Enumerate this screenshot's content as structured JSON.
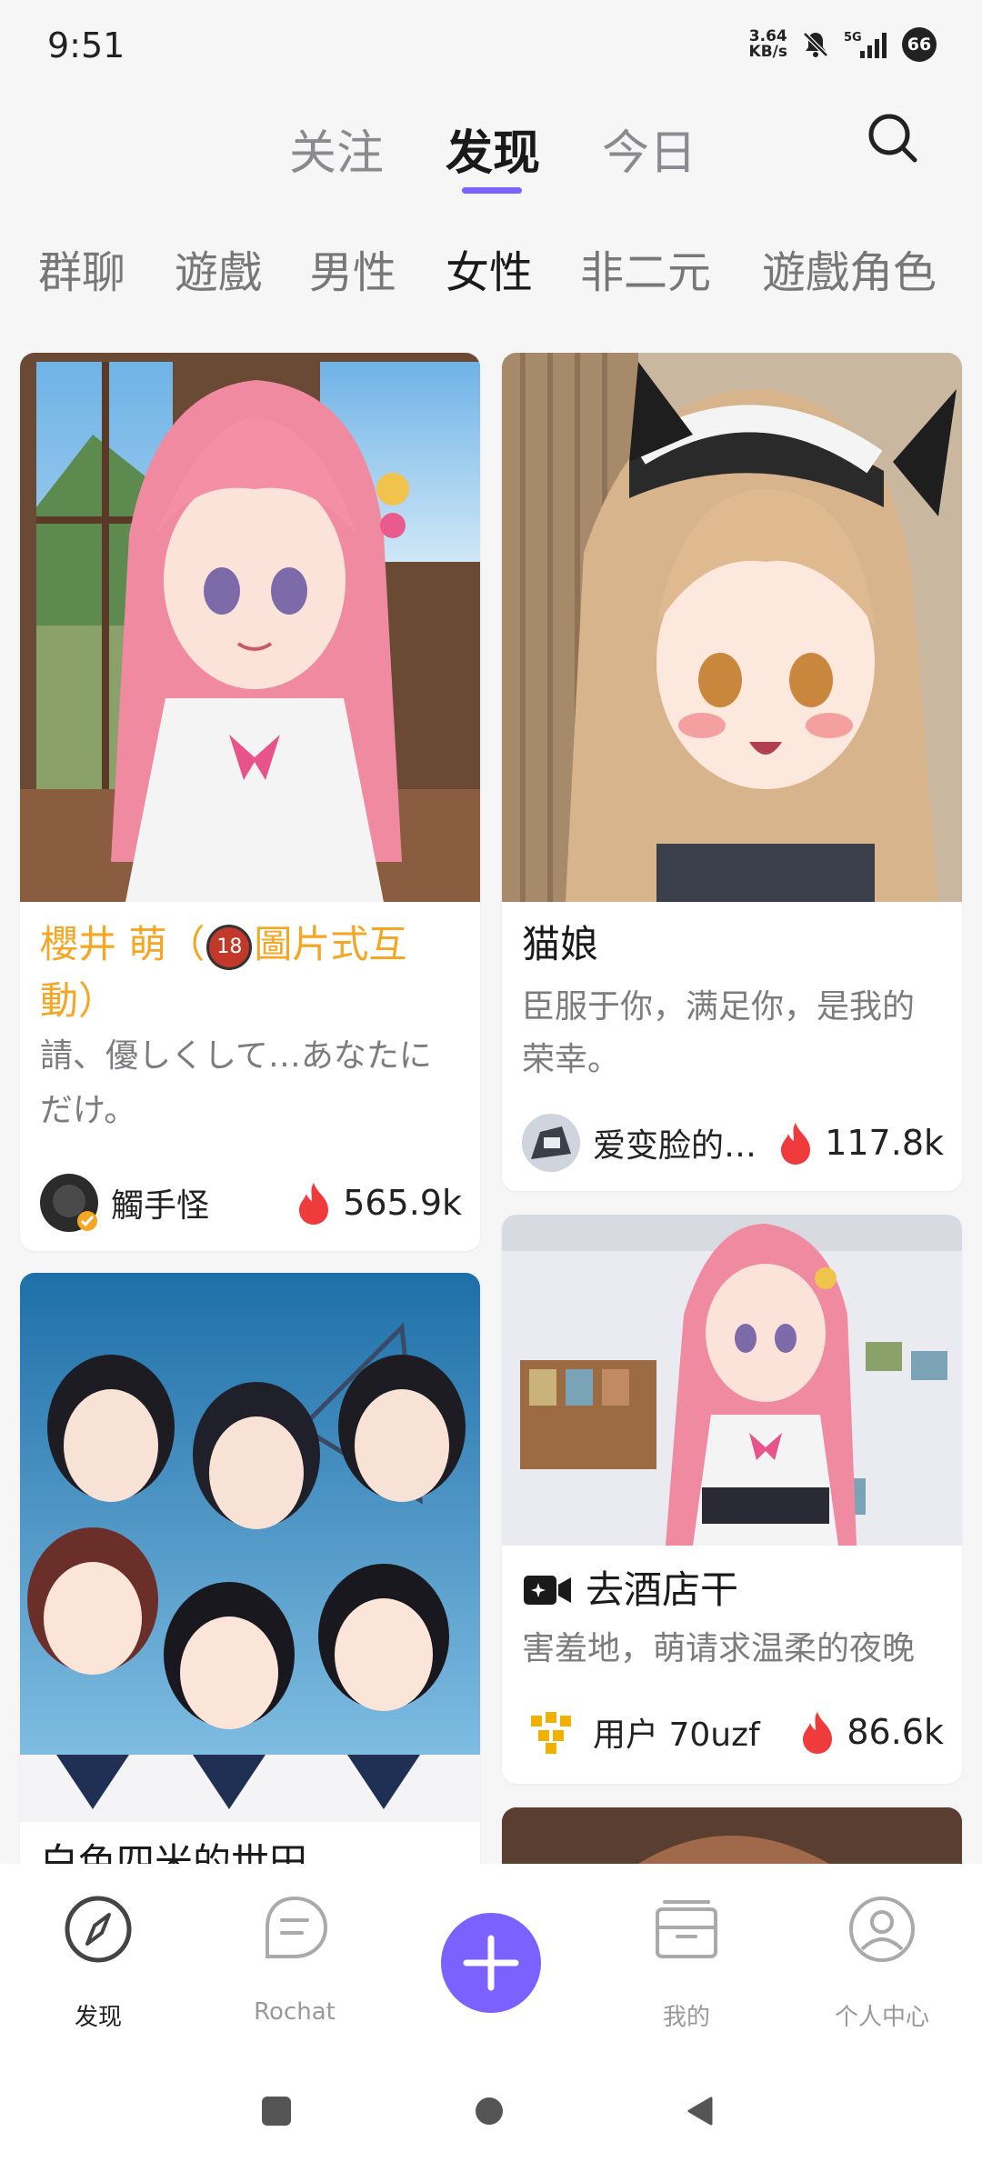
{
  "status": {
    "time": "9:51",
    "net_speed_value": "3.64",
    "net_speed_unit": "KB/s",
    "network": "5G",
    "battery": "66"
  },
  "top_tabs": [
    {
      "label": "关注",
      "active": false
    },
    {
      "label": "发现",
      "active": true
    },
    {
      "label": "今日",
      "active": false
    }
  ],
  "categories": [
    {
      "label": "群聊",
      "active": false
    },
    {
      "label": "遊戲",
      "active": false
    },
    {
      "label": "男性",
      "active": false
    },
    {
      "label": "女性",
      "active": true
    },
    {
      "label": "非二元",
      "active": false
    },
    {
      "label": "遊戲角色",
      "active": false
    }
  ],
  "cards": [
    {
      "title_line1": "櫻井 萌（",
      "title_rating": "18",
      "title_line1_after": "圖片式互",
      "title_line2": "動）",
      "title_color": "#f5a623",
      "desc_line1": "請、優しくして…あなたに",
      "desc_line2": "だけ。",
      "author": "觸手怪",
      "count": "565.9k"
    },
    {
      "title": "猫娘",
      "desc_line1": "臣服于你，满足你，是我的",
      "desc_line2": "荣幸。",
      "author": "爱变脸的…",
      "count": "117.8k"
    },
    {
      "title": "去酒店干",
      "desc": "害羞地，萌请求温柔的夜晚",
      "author": "用户 70uzf",
      "count": "86.6k"
    },
    {
      "title_partial": "白色四米的世田"
    }
  ],
  "nav": {
    "discover": "发现",
    "rochat": "Rochat",
    "mine": "我的",
    "profile": "个人中心"
  },
  "colors": {
    "accent": "#7b61ff",
    "fire": "#ef3b3b",
    "title_orange": "#f5a623"
  }
}
